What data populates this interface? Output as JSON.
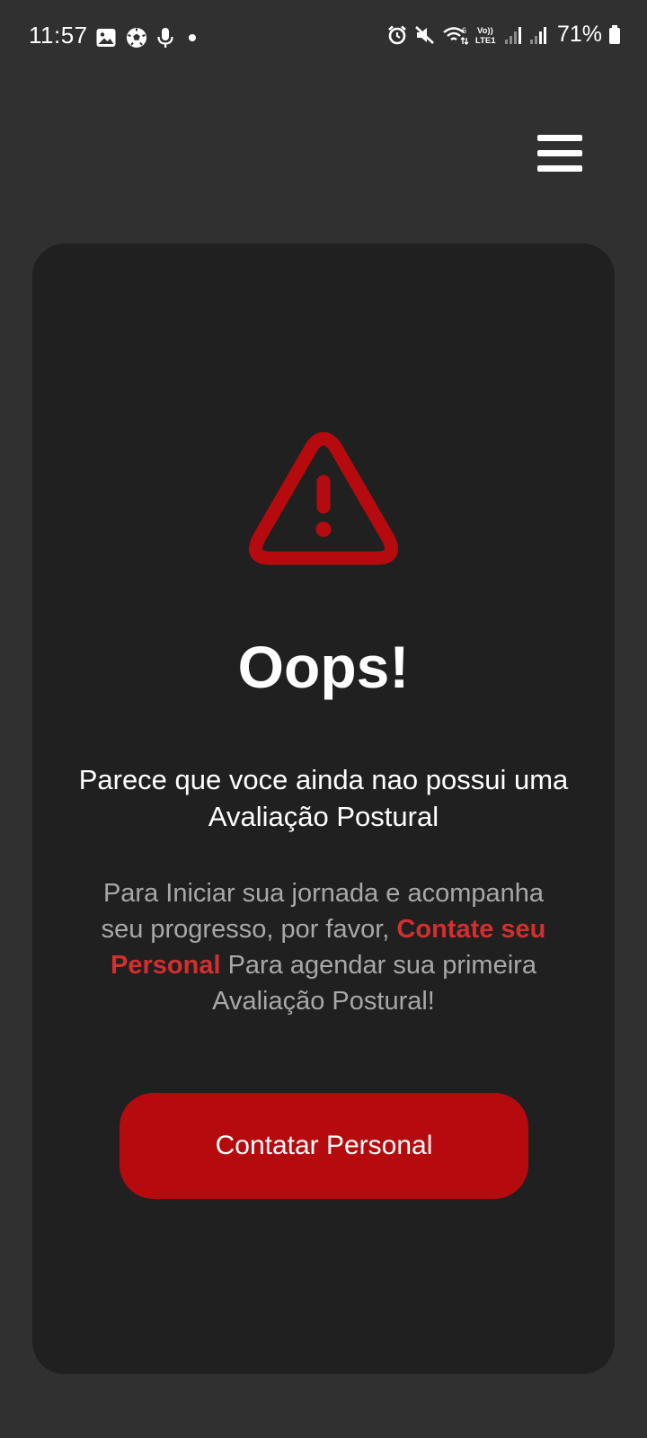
{
  "status_bar": {
    "time": "11:57",
    "battery": "71%",
    "left_icons": [
      "image-icon",
      "soccer-ball-icon",
      "microphone-icon",
      "dot-icon"
    ],
    "right_icons": [
      "alarm-icon",
      "mute-icon",
      "wifi-icon",
      "volte-icon",
      "signal-icon",
      "signal-icon",
      "battery-icon"
    ]
  },
  "header": {
    "menu_icon": "hamburger-menu-icon"
  },
  "card": {
    "icon": "warning-triangle-icon",
    "title": "Oops!",
    "subtitle": "Parece que voce ainda nao possui uma Avaliação Postural",
    "description_before": "Para Iniciar sua jornada e acompanha seu progresso, por favor, ",
    "description_highlight": "Contate seu Personal",
    "description_after": " Para agendar sua primeira Avaliação Postural!",
    "button_label": "Contatar Personal"
  },
  "colors": {
    "background": "#303030",
    "card": "#202020",
    "accent": "#b50b0f",
    "highlight_text": "#d32f2f",
    "muted_text": "#a8a8a8"
  }
}
